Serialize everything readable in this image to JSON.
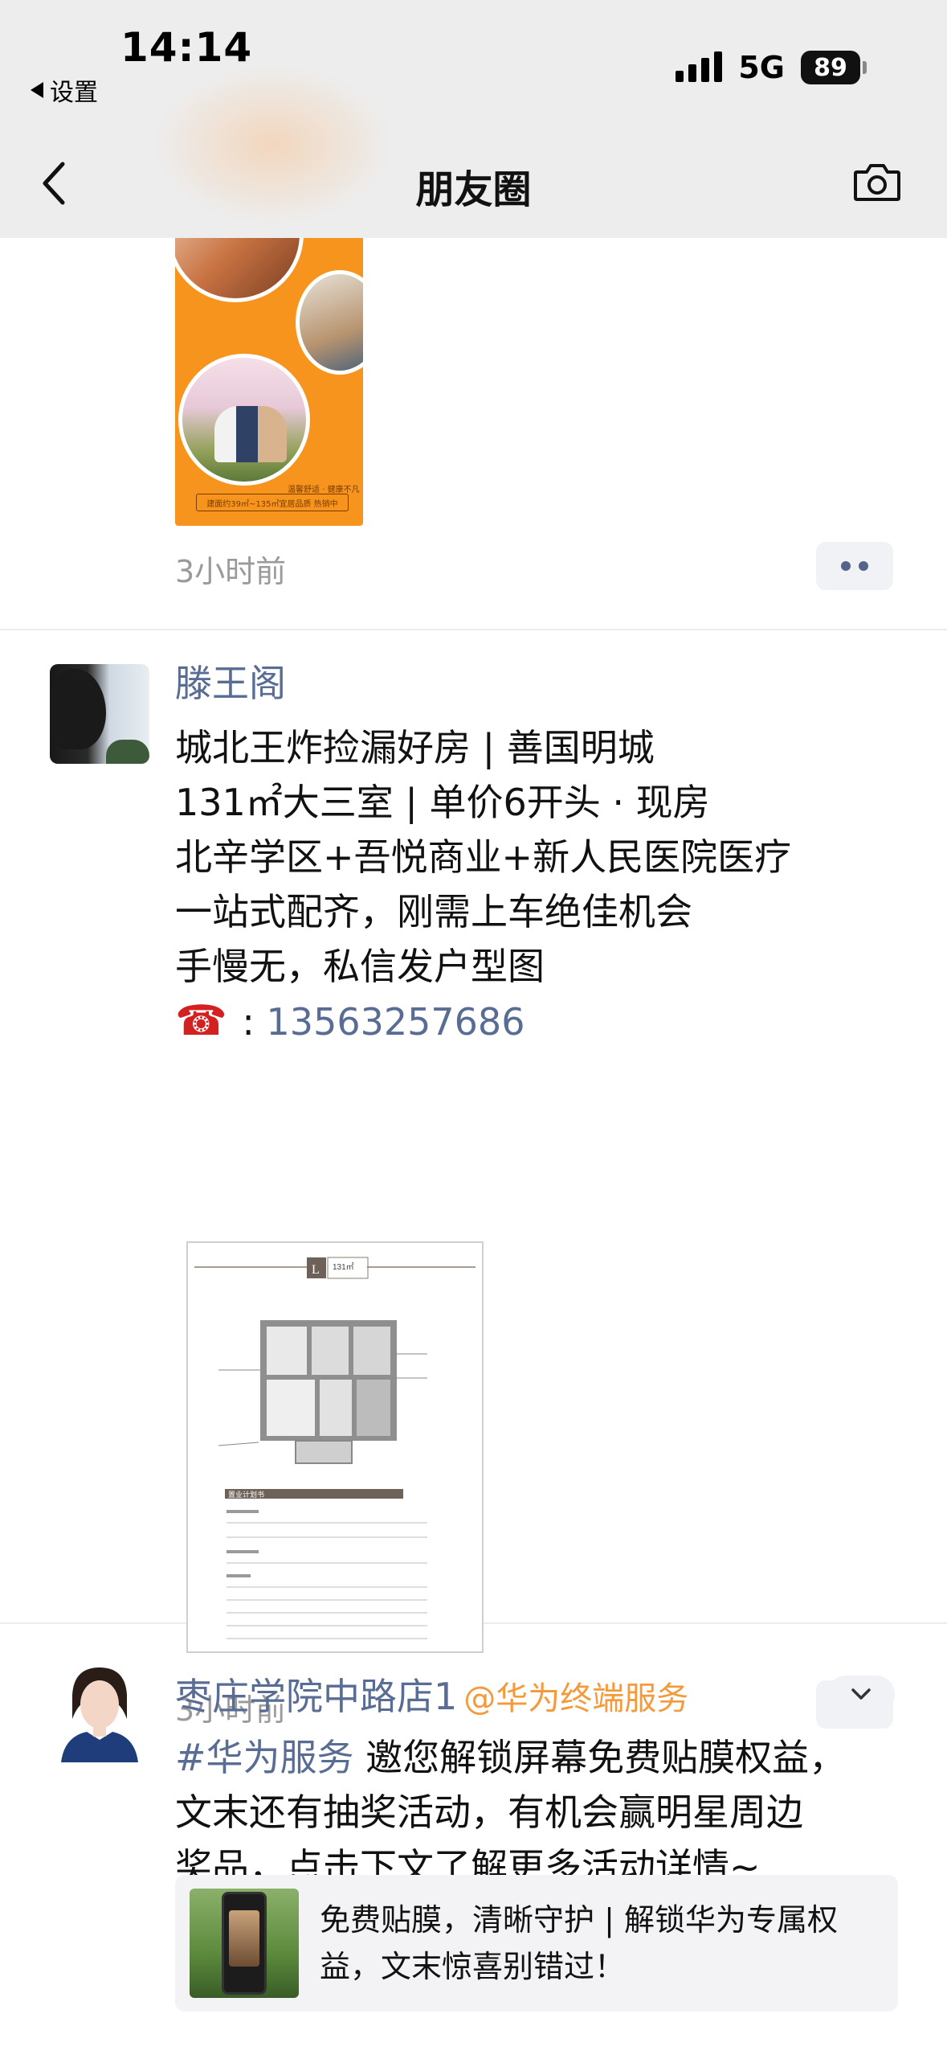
{
  "status_bar": {
    "time": "14:14",
    "back_app": "设置",
    "network": "5G",
    "battery": "89"
  },
  "nav": {
    "title": "朋友圈"
  },
  "posts": [
    {
      "time": "3小时前",
      "image_note": "温馨舒适 · 健康不凡",
      "image_strip": "建面约39㎡~135㎡宜居品质 热销中"
    },
    {
      "name": "滕王阁",
      "lines": [
        "城北王炸捡漏好房 | 善国明城",
        "131㎡大三室 | 单价6开头 · 现房",
        "北辛学区+吾悦商业+新人民医院医疗",
        "一站式配齐，刚需上车绝佳机会",
        "手慢无，私信发户型图"
      ],
      "phone_icon": "☎",
      "phone_sep": ":",
      "phone": "13563257686",
      "floorplan": {
        "badge": "L",
        "area": "131㎡",
        "section": "置业计划书"
      },
      "time": "3小时前"
    },
    {
      "name": "枣庄学院中路店1",
      "source": "@华为终端服务",
      "hashtag": "#华为服务",
      "lines": [
        " 邀您解锁屏幕免费贴膜权益，",
        "文末还有抽奖活动，有机会赢明星周边",
        "奖品，点击下文了解更多活动详情~"
      ],
      "link_card": {
        "lines": [
          "免费贴膜，清晰守护 | 解锁华为专属权",
          "益，文末惊喜别错过！"
        ]
      }
    }
  ],
  "colors": {
    "nickname": "#586c94",
    "source": "#f59a3a",
    "time": "#9a9a9a",
    "topbar_bg": "#ededed"
  }
}
